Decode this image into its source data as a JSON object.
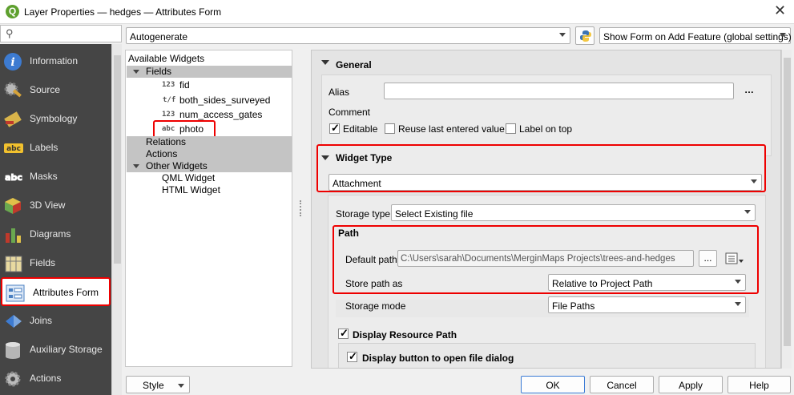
{
  "window": {
    "title": "Layer Properties — hedges — Attributes Form"
  },
  "sidebar": {
    "items": [
      {
        "label": "Information",
        "icon": "info-icon"
      },
      {
        "label": "Source",
        "icon": "source-gear-icon"
      },
      {
        "label": "Symbology",
        "icon": "symbology-brush-icon"
      },
      {
        "label": "Labels",
        "icon": "labels-abc-icon"
      },
      {
        "label": "Masks",
        "icon": "masks-abc-icon"
      },
      {
        "label": "3D View",
        "icon": "cube-3d-icon"
      },
      {
        "label": "Diagrams",
        "icon": "diagrams-icon"
      },
      {
        "label": "Fields",
        "icon": "fields-table-icon"
      },
      {
        "label": "Attributes Form",
        "icon": "attributes-form-icon"
      },
      {
        "label": "Joins",
        "icon": "joins-icon"
      },
      {
        "label": "Auxiliary Storage",
        "icon": "database-icon"
      },
      {
        "label": "Actions",
        "icon": "actions-gear-icon"
      }
    ],
    "active": "Attributes Form"
  },
  "toolbar": {
    "layout_mode": "Autogenerate",
    "python_icon": "python-icon",
    "show_form": "Show Form on Add Feature (global settings)"
  },
  "tree": {
    "header": "Available Widgets",
    "fields_label": "Fields",
    "fields": [
      {
        "type": "123",
        "name": "fid"
      },
      {
        "type": "t/f",
        "name": "both_sides_surveyed"
      },
      {
        "type": "123",
        "name": "num_access_gates"
      },
      {
        "type": "abc",
        "name": "photo"
      }
    ],
    "relations": "Relations",
    "actions": "Actions",
    "other_widgets": "Other Widgets",
    "other": [
      "QML Widget",
      "HTML Widget"
    ]
  },
  "general": {
    "title": "General",
    "alias_label": "Alias",
    "alias_value": "",
    "alias_expr_btn": "…",
    "comment_label": "Comment",
    "editable": {
      "label": "Editable",
      "checked": true
    },
    "reuse": {
      "label": "Reuse last entered value",
      "checked": false
    },
    "label_on_top": {
      "label": "Label on top",
      "checked": false
    }
  },
  "widget_type": {
    "title": "Widget Type",
    "value": "Attachment",
    "storage_type_label": "Storage type",
    "storage_type_value": "Select Existing file",
    "path_title": "Path",
    "default_path_label": "Default path",
    "default_path_value": "C:\\Users\\sarah\\Documents\\MerginMaps Projects\\trees-and-hedges",
    "browse_btn": "...",
    "store_path_label": "Store path as",
    "store_path_value": "Relative to Project Path",
    "storage_mode_label": "Storage mode",
    "storage_mode_value": "File Paths",
    "display_resource_path": {
      "label": "Display Resource Path",
      "checked": true
    },
    "display_button": {
      "label": "Display button to open file dialog",
      "checked": true
    }
  },
  "footer": {
    "style": "Style",
    "ok": "OK",
    "cancel": "Cancel",
    "apply": "Apply",
    "help": "Help"
  },
  "colors": {
    "highlight": "#e00000",
    "sidebar_bg": "#454545"
  }
}
